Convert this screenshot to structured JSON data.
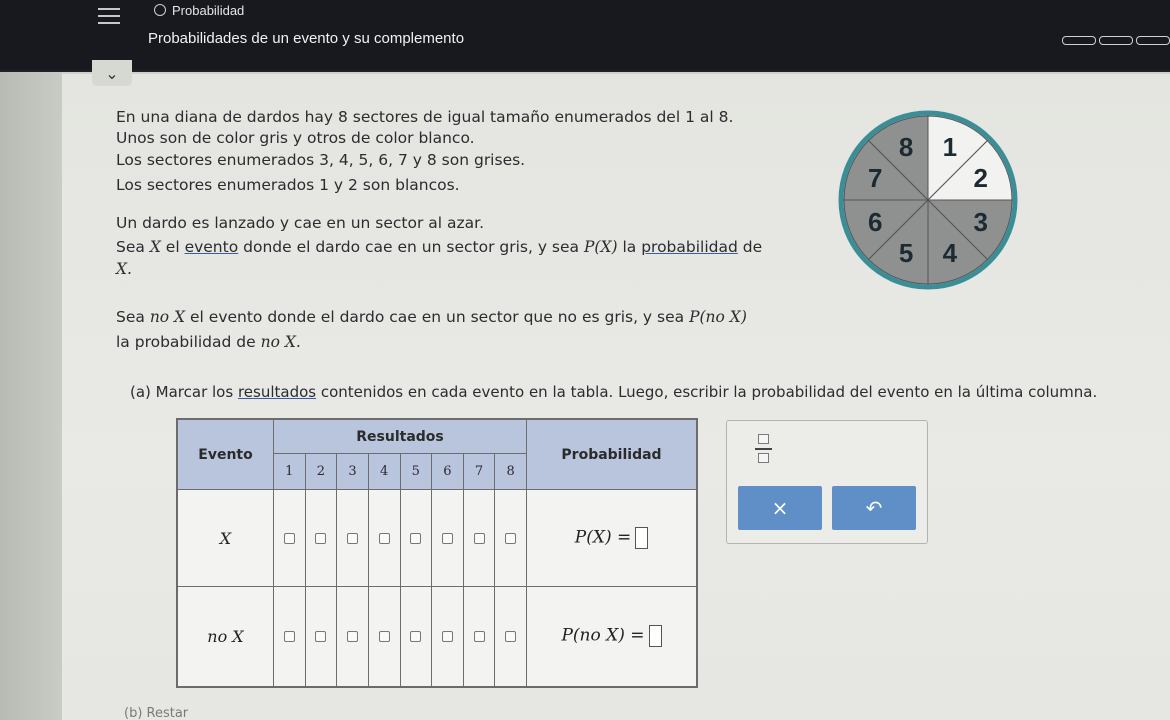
{
  "header": {
    "breadcrumb": "Probabilidad",
    "title": "Probabilidades de un evento y su complemento"
  },
  "problem": {
    "line1": "En una diana de dardos hay 8 sectores de igual tamaño enumerados del 1 al 8.",
    "line2": "Unos son de color gris y otros de color blanco.",
    "line3": "Los sectores enumerados 3, 4, 5, 6, 7 y 8 son grises.",
    "line4": "Los sectores enumerados 1 y 2 son blancos.",
    "line5": "Un dardo es lanzado y cae en un sector al azar.",
    "line6a": "Sea ",
    "line6x": "X",
    "line6b": " el ",
    "line6evento": "evento",
    "line6c": " donde el dardo cae en un sector gris, y sea ",
    "line6px": "P(X)",
    "line6d": " la ",
    "line6prob": "probabilidad",
    "line6e": " de",
    "line7": "X.",
    "line8a": "Sea ",
    "line8no": "no X",
    "line8b": " el evento donde el dardo cae en un sector que no es gris, y sea ",
    "line8p": "P(no X)",
    "line9a": "la probabilidad de ",
    "line9b": "no X."
  },
  "part_a": {
    "prefix": "(a)  Marcar los ",
    "resultados": "resultados",
    "suffix": " contenidos en cada evento en la tabla. Luego, escribir la probabilidad del evento en la última columna."
  },
  "dartboard": {
    "sector_labels": [
      "1",
      "2",
      "3",
      "4",
      "5",
      "6",
      "7",
      "8"
    ],
    "gray_sectors": [
      3,
      4,
      5,
      6,
      7,
      8
    ],
    "white_sectors": [
      1,
      2
    ],
    "gray_color": "#8e918f",
    "rim_color": "#3b8d96"
  },
  "table": {
    "col_evento": "Evento",
    "col_resultados": "Resultados",
    "col_probabilidad": "Probabilidad",
    "outcomes": [
      "1",
      "2",
      "3",
      "4",
      "5",
      "6",
      "7",
      "8"
    ],
    "rows": [
      {
        "event": "X",
        "prob_label": "P(X) ="
      },
      {
        "event": "no X",
        "prob_label": "P(no X) ="
      }
    ]
  },
  "tools": {
    "fraction_icon": "fraction-icon",
    "clear_label": "×",
    "undo_label": "↶"
  },
  "part_b": "(b)  Restar"
}
